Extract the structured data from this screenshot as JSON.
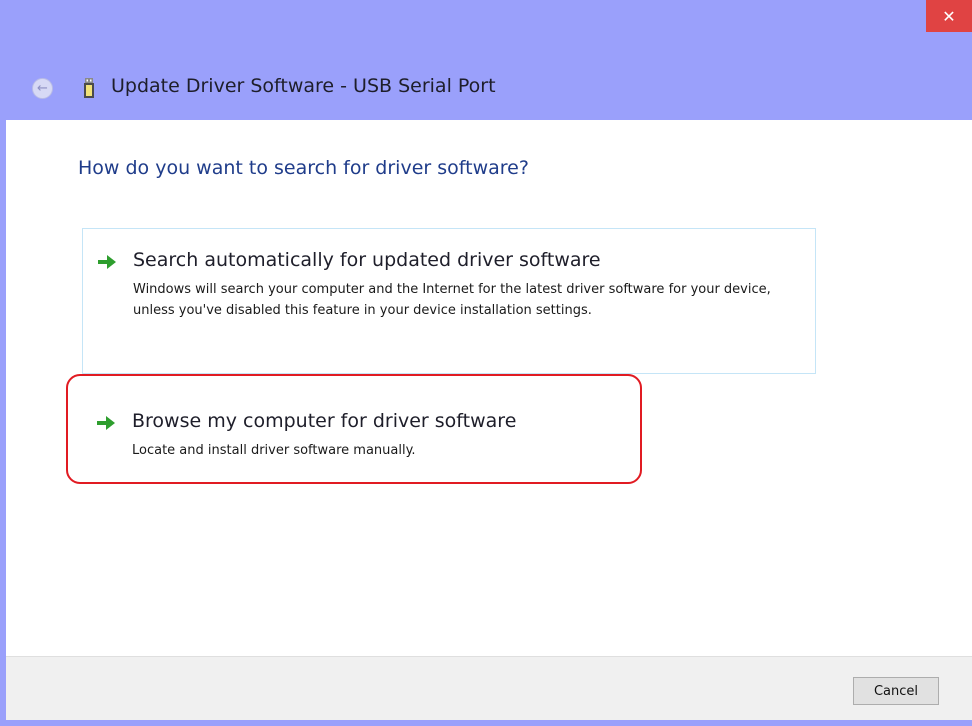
{
  "window": {
    "title": "Update Driver Software - USB Serial Port",
    "close_glyph": "✕",
    "back_glyph": "←",
    "frame_color": "#9aa0fb",
    "close_color": "#e04343"
  },
  "page": {
    "question": "How do you want to search for driver software?"
  },
  "options": [
    {
      "title": "Search automatically for updated driver software",
      "description": "Windows will search your computer and the Internet for the latest driver software for your device, unless you've disabled this feature in your device installation settings.",
      "icon": "green-arrow-icon"
    },
    {
      "title": "Browse my computer for driver software",
      "description": "Locate and install driver software manually.",
      "icon": "green-arrow-icon"
    }
  ],
  "footer": {
    "cancel_label": "Cancel"
  },
  "colors": {
    "heading_blue": "#1f3c8a",
    "arrow_green": "#2e9e2e",
    "highlight_red": "#e11b22"
  }
}
